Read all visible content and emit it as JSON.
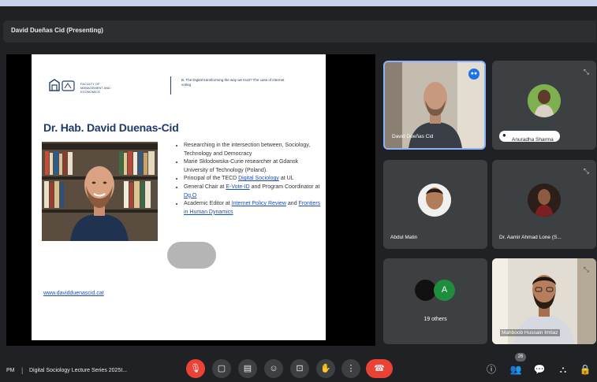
{
  "header": {
    "presenting": "David Dueñas Cid (Presenting)"
  },
  "slide": {
    "logo_text": "FACULTY OF MANAGEMENT AND ECONOMICS",
    "topic": "B. The Digital transforming the way we trust? The case of internet voting",
    "name": "Dr. Hab. David Duenas-Cid",
    "bullets": [
      {
        "text": "Researching in the intersection between, Sociology, Technology and Democracy"
      },
      {
        "text": "Marie Sklodowska-Curie researcher at Gdansk University of Technology (Poland)."
      },
      {
        "text": "Principal of the TECD ",
        "link": "Digital Sociology",
        "after": " at"
      },
      {
        "text": "UL"
      },
      {
        "text": "General Chair at ",
        "link": "E-Vote-ID",
        "after": " and Program Coordinator at ",
        "link2": "Dg.O"
      },
      {
        "text": "Academic Editor at ",
        "link": "Internet Policy Review",
        "after": " and ",
        "link2": "Frontiers in Human Dynamics"
      }
    ],
    "url": "www.davidduenascid.cat"
  },
  "participants": {
    "cid": "David Dueñas Cid",
    "anuradha": "Anuradha Sharma",
    "abdul": "Abdul Matin",
    "aamir": "Dr. Aamir Ahmad Lone (S...",
    "others_initial": "A",
    "others": "19 others",
    "mahboob": "Mahboob Hussain Imtiaz"
  },
  "bottom": {
    "time": "PM",
    "title": "Digital Sociology Lecture Series 2025I...",
    "people_count": "26"
  },
  "colors": {
    "accent": "#8ab4f8",
    "mic_off": "#ea4335",
    "end_call": "#ea4335",
    "control_bg": "#3c4043",
    "meeting_bg": "#202124",
    "tile_bg": "#3c4043",
    "others_avatar": "#1e8e3e"
  },
  "icons": {
    "mic": "mic-off-icon",
    "camera": "camera-icon",
    "captions": "captions-icon",
    "emoji": "emoji-icon",
    "present": "present-icon",
    "hand": "raise-hand-icon",
    "more": "more-vert-icon",
    "end": "end-call-icon",
    "info": "info-icon",
    "people": "people-icon",
    "chat": "chat-icon",
    "activities": "activities-icon",
    "lock": "host-controls-icon"
  }
}
